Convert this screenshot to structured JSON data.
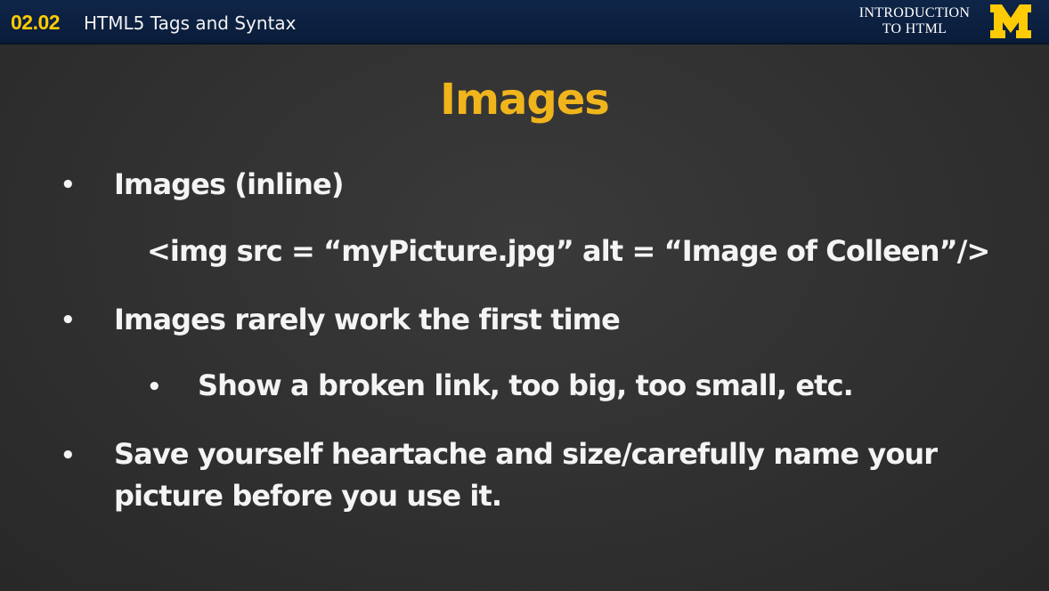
{
  "header": {
    "lesson_code": "02.02",
    "lesson_title": "HTML5 Tags and Syntax",
    "course_name_line1": "INTRODUCTION",
    "course_name_line2": "TO HTML",
    "logo_icon": "michigan-block-m-icon",
    "logo_color": "#ffcb05"
  },
  "slide": {
    "title": "Images",
    "title_color": "#f0b51c",
    "bullets": [
      {
        "text": "Images (inline)",
        "code": "<img src = “myPicture.jpg” alt = “Image of Colleen”/>"
      },
      {
        "text": "Images rarely work the first time",
        "sub_bullets": [
          "Show a broken link, too big, too small, etc."
        ]
      },
      {
        "text_line1": "Save yourself heartache and size/carefully name your",
        "text_line2": "picture before you use it."
      }
    ],
    "bullet_symbol": "•"
  }
}
